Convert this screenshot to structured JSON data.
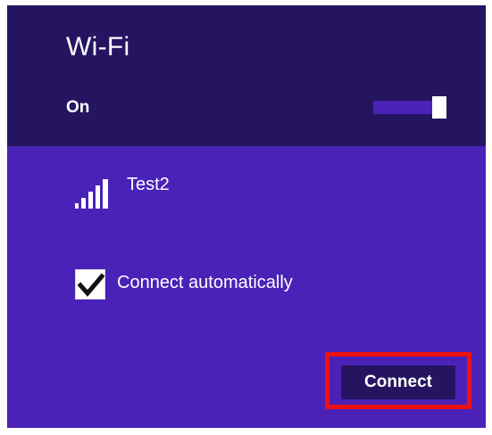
{
  "panel": {
    "title": "Wi-Fi",
    "wifi_state_label": "On",
    "wifi_enabled": true
  },
  "network": {
    "name": "Test2",
    "signal_icon": "signal-bars-icon",
    "signal_bars": 5
  },
  "options": {
    "connect_automatically": {
      "label": "Connect automatically",
      "checked": true
    }
  },
  "actions": {
    "connect_label": "Connect"
  },
  "colors": {
    "header_bg": "#251560",
    "panel_bg": "#4a22b8",
    "highlight_outline": "#ee1111",
    "text": "#ffffff"
  }
}
